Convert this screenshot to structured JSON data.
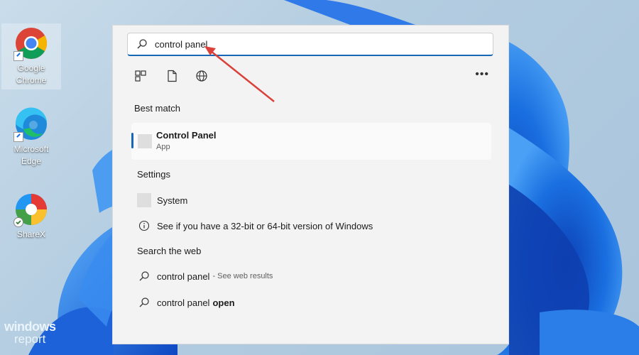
{
  "desktop": {
    "icons": [
      {
        "label_line1": "Google",
        "label_line2": "Chrome",
        "icon": "chrome-icon"
      },
      {
        "label_line1": "Microsoft",
        "label_line2": "Edge",
        "icon": "edge-icon"
      },
      {
        "label_line1": "ShareX",
        "label_line2": "",
        "icon": "sharex-icon"
      }
    ],
    "watermark": {
      "line1": "windows",
      "line2": "report"
    }
  },
  "search": {
    "query": "control panel",
    "filters": [
      "apps-filter-icon",
      "documents-filter-icon",
      "web-filter-icon"
    ],
    "more_icon": "more-options-icon",
    "more_label": "•••"
  },
  "best_match": {
    "title": "Best match",
    "item": {
      "name": "Control Panel",
      "type": "App"
    }
  },
  "settings": {
    "title": "Settings",
    "items": [
      {
        "label": "System",
        "icon": "system-app-icon"
      },
      {
        "label": "See if you have a 32-bit or 64-bit version of Windows",
        "icon": "info-icon"
      }
    ]
  },
  "web": {
    "title": "Search the web",
    "items": [
      {
        "text": "control panel",
        "suffix": "- See web results"
      },
      {
        "text": "control panel",
        "bold": "open"
      }
    ]
  },
  "colors": {
    "accent": "#1767b6",
    "arrow": "#d9413a"
  }
}
